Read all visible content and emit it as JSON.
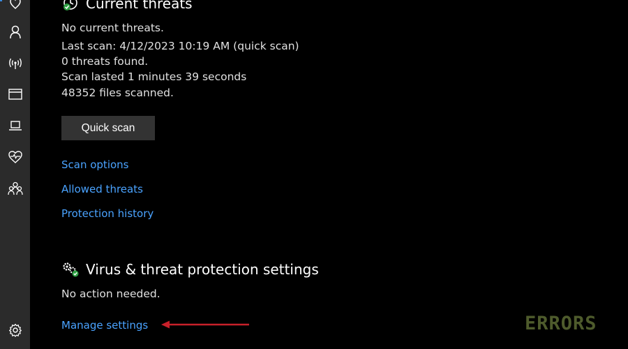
{
  "sidebar": {
    "items": [
      {
        "icon": "shield-icon"
      },
      {
        "icon": "person-icon"
      },
      {
        "icon": "wireless-icon"
      },
      {
        "icon": "window-icon"
      },
      {
        "icon": "laptop-icon"
      },
      {
        "icon": "heart-pulse-icon"
      },
      {
        "icon": "family-icon"
      },
      {
        "icon": "settings-gear-icon"
      }
    ],
    "accent_color": "#3a8be0"
  },
  "current_threats": {
    "title": "Current threats",
    "status": "No current threats.",
    "last_scan": "Last scan: 4/12/2023 10:19 AM (quick scan)",
    "threats_found": "0 threats found.",
    "scan_duration": "Scan lasted 1 minutes 39 seconds",
    "files_scanned": "48352 files scanned.",
    "quick_scan_button": "Quick scan",
    "links": {
      "scan_options": "Scan options",
      "allowed_threats": "Allowed threats",
      "protection_history": "Protection history"
    }
  },
  "protection_settings": {
    "title": "Virus & threat protection settings",
    "status": "No action needed.",
    "manage_link": "Manage settings"
  },
  "colors": {
    "link": "#4aa3ff",
    "annotation_arrow": "#c8202a",
    "status_ok": "#2ea043"
  },
  "watermark": {
    "logo_text": "ERRORS"
  }
}
